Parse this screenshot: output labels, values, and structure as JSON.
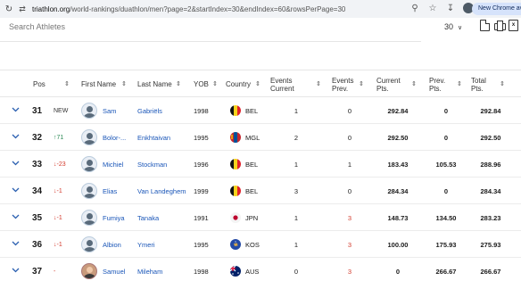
{
  "browser": {
    "url_host": "triathlon.org",
    "url_path": "/world-rankings/duathlon/men?page=2&startIndex=30&endIndex=60&rowsPerPage=30",
    "chrome_button": "New Chrome avai"
  },
  "toolbar": {
    "search_placeholder": "Search Athletes",
    "rows_per_page": "30"
  },
  "columns": [
    {
      "label": "Pos"
    },
    {
      "label": "First Name"
    },
    {
      "label": "Last Name"
    },
    {
      "label": "YOB"
    },
    {
      "label": "Country"
    },
    {
      "label": "Events Current"
    },
    {
      "label": "Events Prev."
    },
    {
      "label": "Current Pts."
    },
    {
      "label": "Prev. Pts."
    },
    {
      "label": "Total Pts."
    }
  ],
  "rows": [
    {
      "pos": "31",
      "move": "NEW",
      "move_dir": "new",
      "first": "Sam",
      "last": "Gabriëls",
      "yob": "1998",
      "country": "BEL",
      "events_current": "1",
      "events_prev": "0",
      "events_prev_red": false,
      "current_pts": "292.84",
      "prev_pts": "0",
      "total_pts": "292.84",
      "photo": false
    },
    {
      "pos": "32",
      "move": "↑71",
      "move_dir": "up",
      "first": "Bolor-...",
      "last": "Enkhtaivan",
      "yob": "1995",
      "country": "MGL",
      "events_current": "2",
      "events_prev": "0",
      "events_prev_red": false,
      "current_pts": "292.50",
      "prev_pts": "0",
      "total_pts": "292.50",
      "photo": false
    },
    {
      "pos": "33",
      "move": "↓-23",
      "move_dir": "down",
      "first": "Michiel",
      "last": "Stockman",
      "yob": "1996",
      "country": "BEL",
      "events_current": "1",
      "events_prev": "1",
      "events_prev_red": false,
      "current_pts": "183.43",
      "prev_pts": "105.53",
      "total_pts": "288.96",
      "photo": false
    },
    {
      "pos": "34",
      "move": "↓-1",
      "move_dir": "down",
      "first": "Elias",
      "last": "Van Landeghem",
      "yob": "1999",
      "country": "BEL",
      "events_current": "3",
      "events_prev": "0",
      "events_prev_red": false,
      "current_pts": "284.34",
      "prev_pts": "0",
      "total_pts": "284.34",
      "photo": false
    },
    {
      "pos": "35",
      "move": "↓-1",
      "move_dir": "down",
      "first": "Fumiya",
      "last": "Tanaka",
      "yob": "1991",
      "country": "JPN",
      "events_current": "1",
      "events_prev": "3",
      "events_prev_red": true,
      "current_pts": "148.73",
      "prev_pts": "134.50",
      "total_pts": "283.23",
      "photo": false
    },
    {
      "pos": "36",
      "move": "↓-1",
      "move_dir": "down",
      "first": "Albion",
      "last": "Ymeri",
      "yob": "1995",
      "country": "KOS",
      "events_current": "1",
      "events_prev": "3",
      "events_prev_red": true,
      "current_pts": "100.00",
      "prev_pts": "175.93",
      "total_pts": "275.93",
      "photo": false
    },
    {
      "pos": "37",
      "move": "-",
      "move_dir": "down",
      "first": "Samuel",
      "last": "Mileham",
      "yob": "1998",
      "country": "AUS",
      "events_current": "0",
      "events_prev": "3",
      "events_prev_red": true,
      "current_pts": "0",
      "prev_pts": "266.67",
      "total_pts": "266.67",
      "photo": true
    }
  ]
}
